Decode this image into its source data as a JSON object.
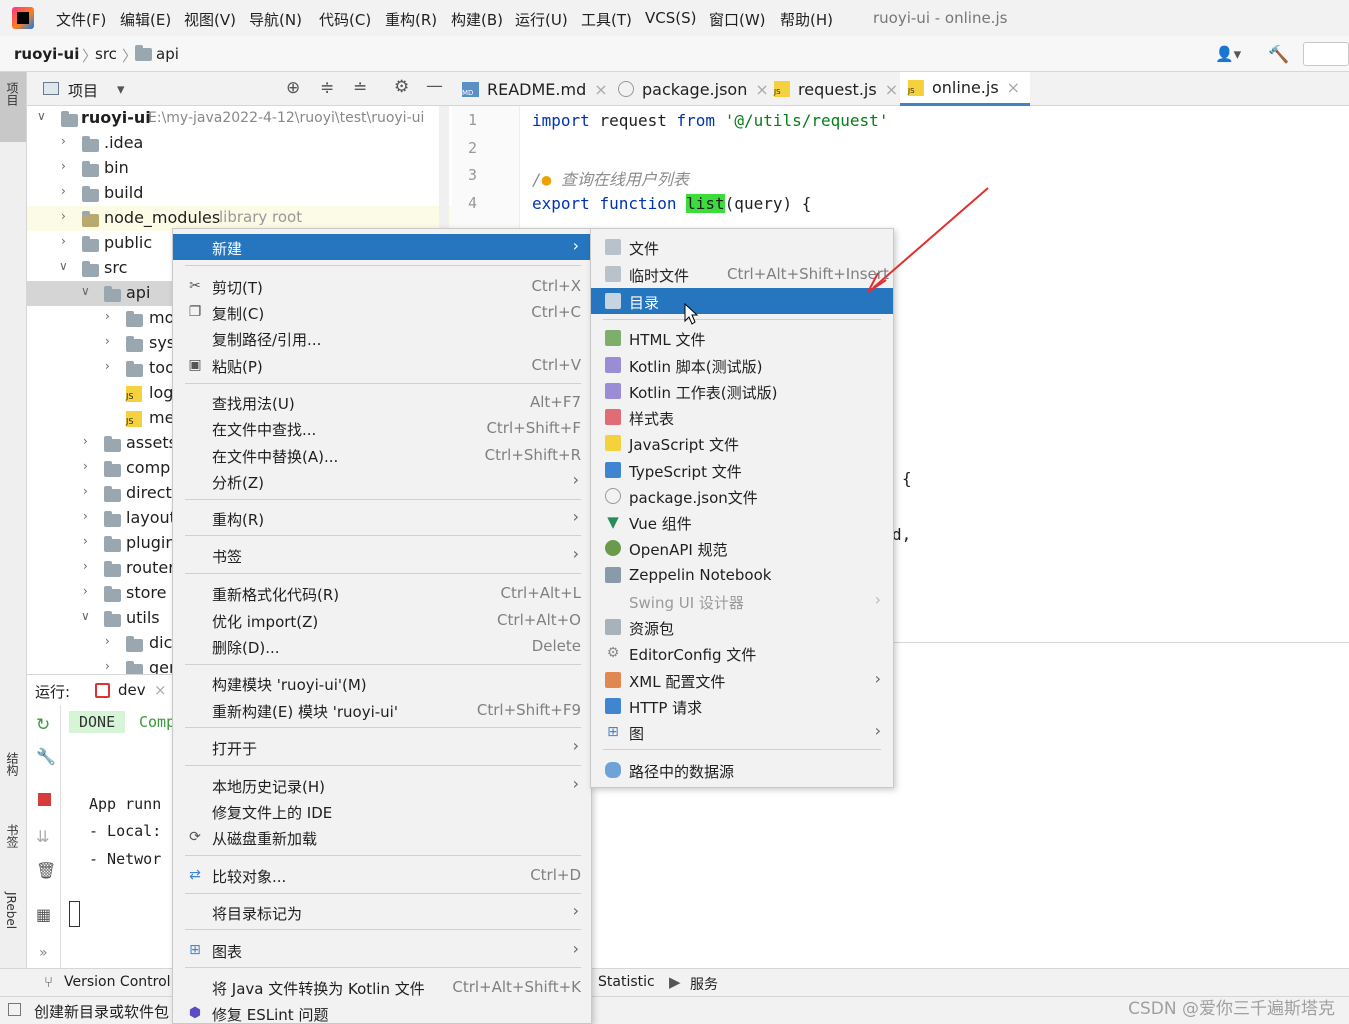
{
  "menubar": {
    "items": [
      "文件(F)",
      "编辑(E)",
      "视图(V)",
      "导航(N)",
      "代码(C)",
      "重构(R)",
      "构建(B)",
      "运行(U)",
      "工具(T)",
      "VCS(S)",
      "窗口(W)",
      "帮助(H)"
    ],
    "window_title": "ruoyi-ui - online.js"
  },
  "breadcrumb": {
    "project": "ruoyi-ui",
    "src": "src",
    "api": "api"
  },
  "left_strip": {
    "project_tab": "项目",
    "structure_tab": "结构",
    "bookmarks_tab": "书签",
    "jrebel_tab": "JRebel"
  },
  "project_panel": {
    "title": "项目",
    "root_name": "ruoyi-ui",
    "root_path": "E:\\my-java2022-4-12\\ruoyi\\test\\ruoyi-ui",
    "library_root_hint": "library root",
    "items": [
      ".idea",
      "bin",
      "build",
      "node_modules",
      "public",
      "src",
      "api",
      "mo",
      "sys",
      "too",
      "log",
      "me",
      "assets",
      "comp",
      "direct",
      "layout",
      "plugin",
      "router",
      "store",
      "utils",
      "dic",
      "ger"
    ]
  },
  "editor_tabs": [
    "README.md",
    "package.json",
    "request.js",
    "online.js"
  ],
  "editor": {
    "line_numbers": [
      "1",
      "2",
      "3",
      "4"
    ],
    "line1": {
      "kw1": "import",
      "ident": "request",
      "kw2": "from",
      "str": "'@/utils/request'"
    },
    "line3": {
      "comment_prefix": "/",
      "comment": "查询在线用户列表"
    },
    "line4": {
      "kw1": "export",
      "kw2": "function",
      "fn": "list",
      "rest": "(query) {"
    },
    "fragment1": "{",
    "fragment2": "d,"
  },
  "run_panel": {
    "label": "运行:",
    "config": "dev",
    "done_badge": "DONE",
    "comp_text": "Comp",
    "lines": [
      "App runn",
      "- Local:",
      "- Networ"
    ]
  },
  "context_menu": {
    "new_label": "新建",
    "cut": {
      "label": "剪切(T)",
      "shortcut": "Ctrl+X"
    },
    "copy": {
      "label": "复制(C)",
      "shortcut": "Ctrl+C"
    },
    "copy_path": {
      "label": "复制路径/引用..."
    },
    "paste": {
      "label": "粘贴(P)",
      "shortcut": "Ctrl+V"
    },
    "find_usages": {
      "label": "查找用法(U)",
      "shortcut": "Alt+F7"
    },
    "find_in_files": {
      "label": "在文件中查找...",
      "shortcut": "Ctrl+Shift+F"
    },
    "replace_in_files": {
      "label": "在文件中替换(A)...",
      "shortcut": "Ctrl+Shift+R"
    },
    "analyze": {
      "label": "分析(Z)"
    },
    "refactor": {
      "label": "重构(R)"
    },
    "bookmarks": {
      "label": "书签"
    },
    "reformat": {
      "label": "重新格式化代码(R)",
      "shortcut": "Ctrl+Alt+L"
    },
    "optimize_imports": {
      "label": "优化 import(Z)",
      "shortcut": "Ctrl+Alt+O"
    },
    "delete": {
      "label": "删除(D)...",
      "shortcut": "Delete"
    },
    "build_module": {
      "label": "构建模块 'ruoyi-ui'(M)"
    },
    "rebuild_module": {
      "label": "重新构建(E) 模块 'ruoyi-ui'",
      "shortcut": "Ctrl+Shift+F9"
    },
    "open_in": {
      "label": "打开于"
    },
    "local_history": {
      "label": "本地历史记录(H)"
    },
    "repair_ide": {
      "label": "修复文件上的 IDE"
    },
    "reload_from_disk": {
      "label": "从磁盘重新加载"
    },
    "compare_with": {
      "label": "比较对象...",
      "shortcut": "Ctrl+D"
    },
    "mark_directory_as": {
      "label": "将目录标记为"
    },
    "diagrams": {
      "label": "图表"
    },
    "convert_java": {
      "label": "将 Java 文件转换为 Kotlin 文件",
      "shortcut": "Ctrl+Alt+Shift+K"
    },
    "fix_eslint": {
      "label": "修复 ESLint 问题"
    }
  },
  "new_submenu": {
    "file": "文件",
    "scratch": {
      "label": "临时文件",
      "shortcut": "Ctrl+Alt+Shift+Insert"
    },
    "directory": "目录",
    "html": "HTML 文件",
    "kotlin_script": "Kotlin 脚本(测试版)",
    "kotlin_worksheet": "Kotlin 工作表(测试版)",
    "stylesheet": "样式表",
    "javascript": "JavaScript 文件",
    "typescript": "TypeScript 文件",
    "package_json": "package.json文件",
    "vue": "Vue 组件",
    "openapi": "OpenAPI 规范",
    "zeppelin": "Zeppelin Notebook",
    "swing": "Swing UI 设计器",
    "resource_bundle": "资源包",
    "editorconfig": "EditorConfig 文件",
    "xml_config": "XML 配置文件",
    "http_request": "HTTP 请求",
    "diagram": "图",
    "data_source": "路径中的数据源"
  },
  "bottom_bar": {
    "version_control": "Version Control",
    "statistic": "Statistic",
    "services": "服务"
  },
  "status_bar": {
    "message": "创建新目录或软件包"
  },
  "watermark": "CSDN @爱你三千遍斯塔克",
  "colors": {
    "selection": "#2675bf",
    "highlight": "#3ddc3d",
    "arrow": "#e03030"
  }
}
